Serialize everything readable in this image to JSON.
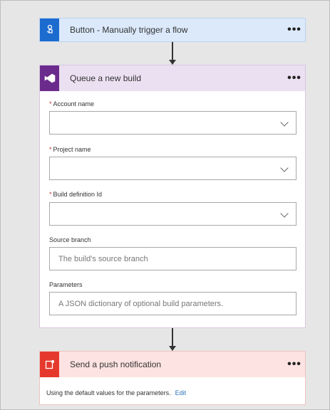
{
  "trigger": {
    "title": "Button - Manually trigger a flow",
    "more": "•••",
    "color": "#dbe9fb",
    "icon_color": "#1c6ccf",
    "icon": "touch-icon"
  },
  "queue": {
    "title": "Queue a new build",
    "more": "•••",
    "color": "#ebe0f1",
    "icon_color": "#6a2b8c",
    "icon": "visual-studio-icon",
    "fields": {
      "account": {
        "label": "Account name",
        "required": "*"
      },
      "project": {
        "label": "Project name",
        "required": "*"
      },
      "build_def": {
        "label": "Build definition Id",
        "required": "*"
      },
      "source_branch": {
        "label": "Source branch",
        "placeholder": "The build's source branch"
      },
      "parameters": {
        "label": "Parameters",
        "placeholder": "A JSON dictionary of optional build parameters."
      }
    }
  },
  "notification": {
    "title": "Send a push notification",
    "more": "•••",
    "color": "#fde3e1",
    "icon_color": "#e5392d",
    "icon": "push-notification-icon",
    "body_text": "Using the default values for the parameters.",
    "edit_label": "Edit"
  }
}
